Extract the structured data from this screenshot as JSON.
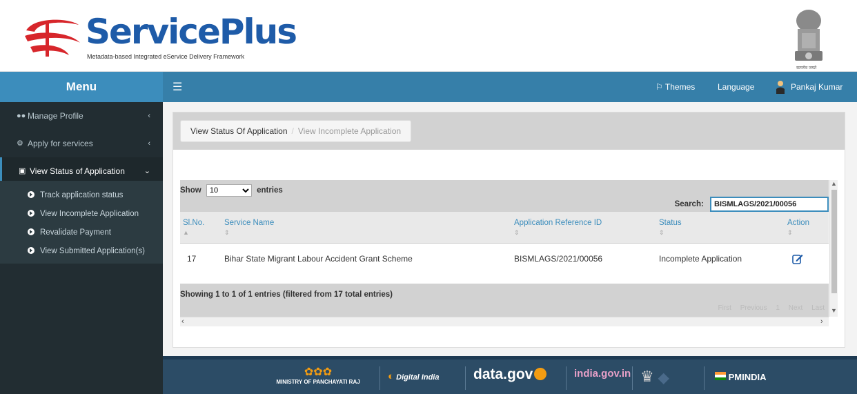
{
  "header": {
    "logo_title": "ServicePlus",
    "logo_subtitle": "Metadata-based Integrated eService Delivery Framework",
    "emblem_caption": "सत्यमेव जयते"
  },
  "topbar": {
    "menu_label": "Menu",
    "themes_label": "Themes",
    "language_label": "Language",
    "user_name": "Pankaj Kumar"
  },
  "sidebar": {
    "items": [
      {
        "label": "Manage Profile",
        "icon": "users-icon"
      },
      {
        "label": "Apply for services",
        "icon": "cogs-icon"
      },
      {
        "label": "View Status of Application",
        "icon": "list-icon"
      }
    ],
    "sub_items": [
      {
        "label": "Track application status"
      },
      {
        "label": "View Incomplete Application"
      },
      {
        "label": "Revalidate Payment"
      },
      {
        "label": "View Submitted Application(s)"
      }
    ]
  },
  "breadcrumb": {
    "current": "View Status Of Application",
    "next": "View Incomplete Application"
  },
  "table": {
    "show_label": "Show",
    "entries_label": "entries",
    "page_length": "10",
    "search_label": "Search:",
    "search_value": "BISMLAGS/2021/00056",
    "columns": [
      "Sl.No.",
      "Service Name",
      "Application Reference ID",
      "Status",
      "Action"
    ],
    "rows": [
      {
        "sl": "17",
        "service": "Bihar State Migrant Labour Accident Grant Scheme",
        "ref": "BISMLAGS/2021/00056",
        "status": "Incomplete Application"
      }
    ],
    "info": "Showing 1 to 1 of 1 entries (filtered from 17 total entries)",
    "pager": {
      "first": "First",
      "previous": "Previous",
      "page": "1",
      "next": "Next",
      "last": "Last"
    }
  },
  "footer": {
    "logos": [
      {
        "label": "MINISTRY OF PANCHAYATI RAJ"
      },
      {
        "label": "Digital India"
      },
      {
        "label": "data.gov"
      },
      {
        "label": "india.gov.in"
      },
      {
        "label": "PMINDIA"
      }
    ]
  },
  "colors": {
    "topbar": "#367fa9",
    "sidebar": "#222d32",
    "accent": "#3c8dbc",
    "footer": "#2c4c66"
  }
}
